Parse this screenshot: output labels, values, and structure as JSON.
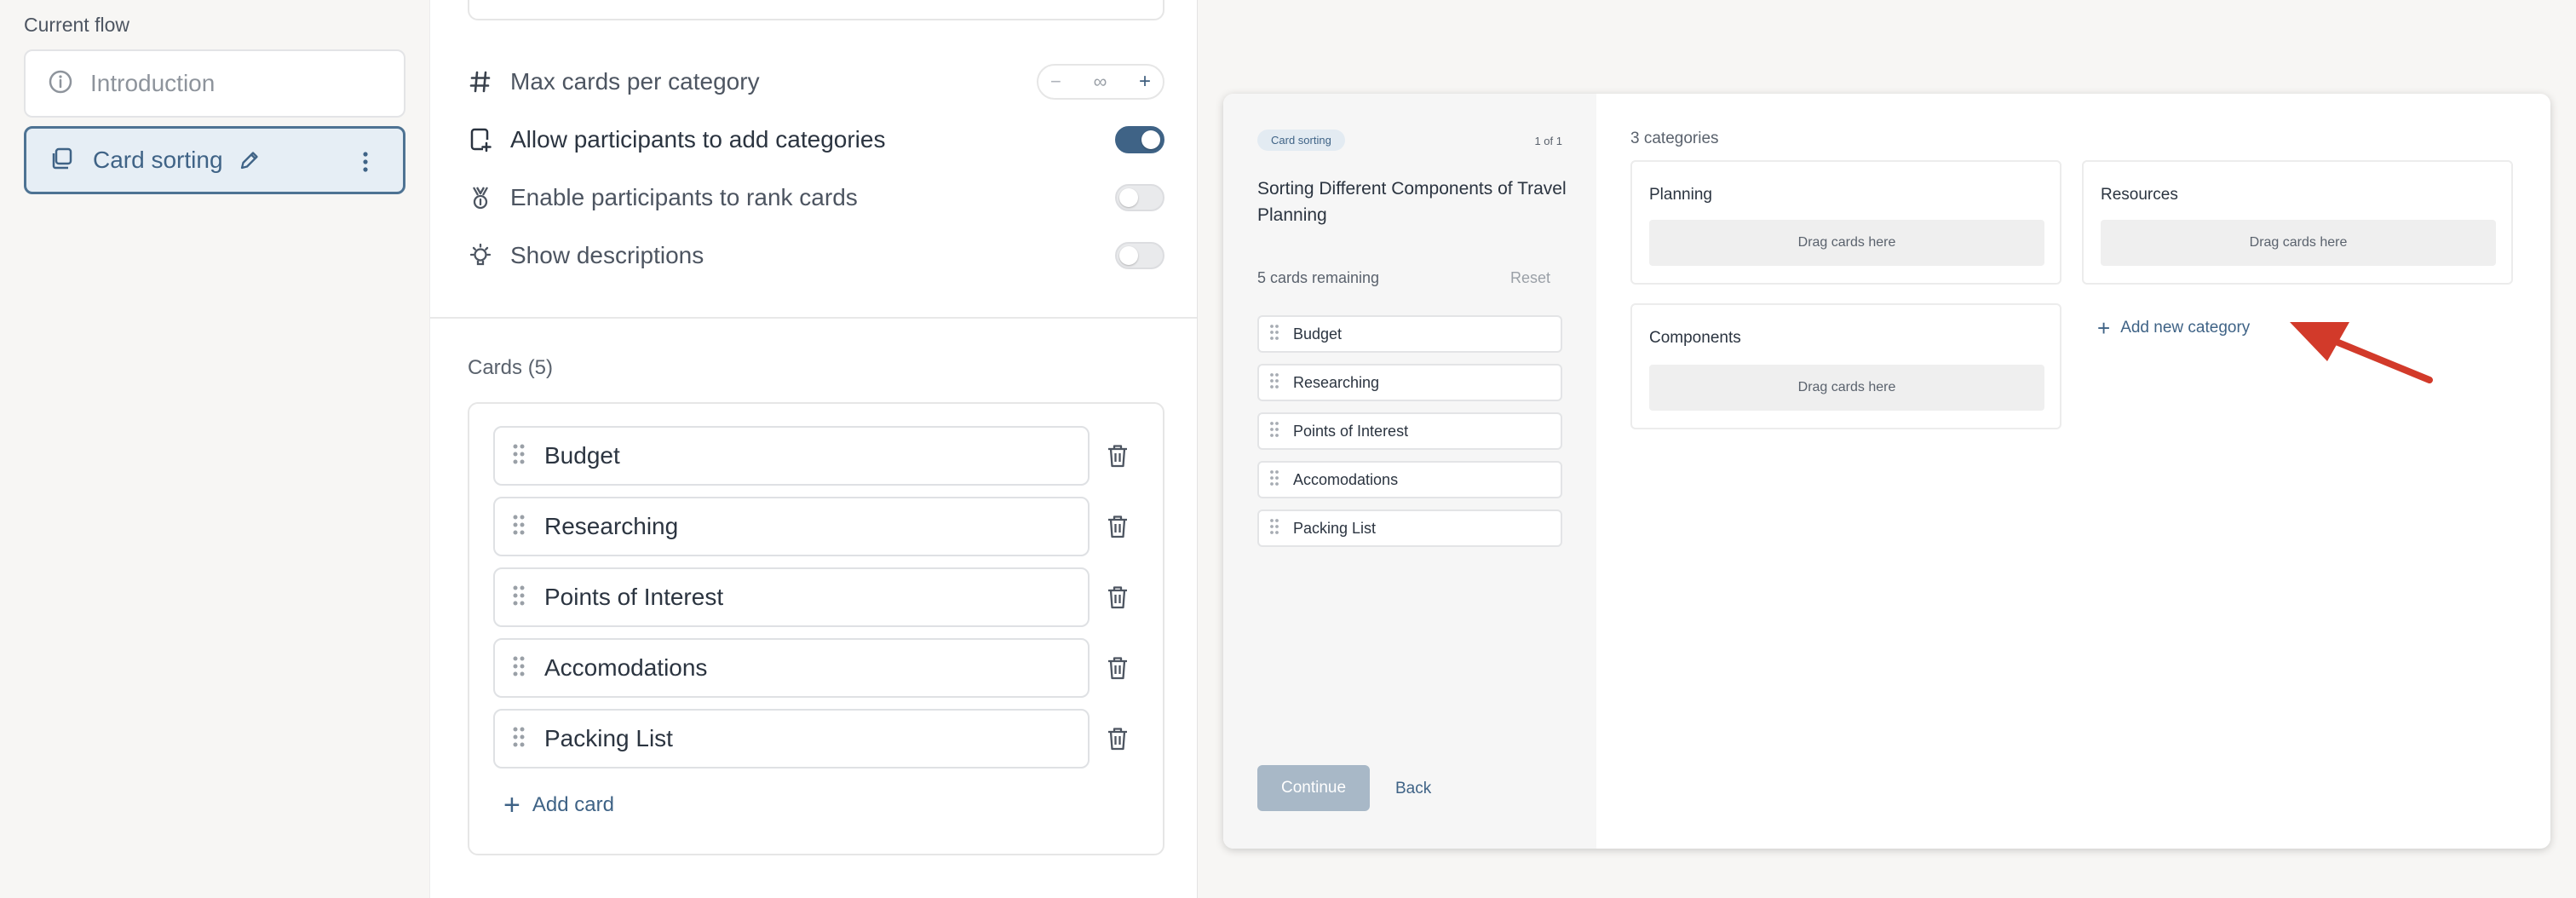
{
  "flow": {
    "title": "Current flow",
    "items": [
      {
        "label": "Introduction",
        "icon": "info-icon"
      },
      {
        "label": "Card sorting",
        "icon": "copy-icon"
      }
    ]
  },
  "settings": {
    "max_cards": {
      "label": "Max cards per category",
      "value": "∞",
      "minus": "−",
      "plus": "+"
    },
    "allow_add": {
      "label": "Allow participants to add categories",
      "on": true
    },
    "rank_cards": {
      "label": "Enable participants to rank cards",
      "on": false
    },
    "descriptions": {
      "label": "Show descriptions",
      "on": false
    },
    "cards_header": "Cards (5)",
    "cards": [
      "Budget",
      "Researching",
      "Points of Interest",
      "Accomodations",
      "Packing List"
    ],
    "add_card": "Add card"
  },
  "preview": {
    "chip": "Card sorting",
    "count": "1 of 1",
    "title": "Sorting Different Components of Travel Planning",
    "remaining": "5 cards remaining",
    "reset": "Reset",
    "cards": [
      "Budget",
      "Researching",
      "Points of Interest",
      "Accomodations",
      "Packing List"
    ],
    "continue": "Continue",
    "back": "Back",
    "categories_count": "3 categories",
    "categories": [
      {
        "name": "Planning",
        "drop": "Drag cards here"
      },
      {
        "name": "Resources",
        "drop": "Drag cards here"
      },
      {
        "name": "Components",
        "drop": "Drag cards here"
      }
    ],
    "add_category": "Add new category"
  },
  "colors": {
    "accent": "#3f6386",
    "annotation_arrow": "#d23a2a"
  }
}
